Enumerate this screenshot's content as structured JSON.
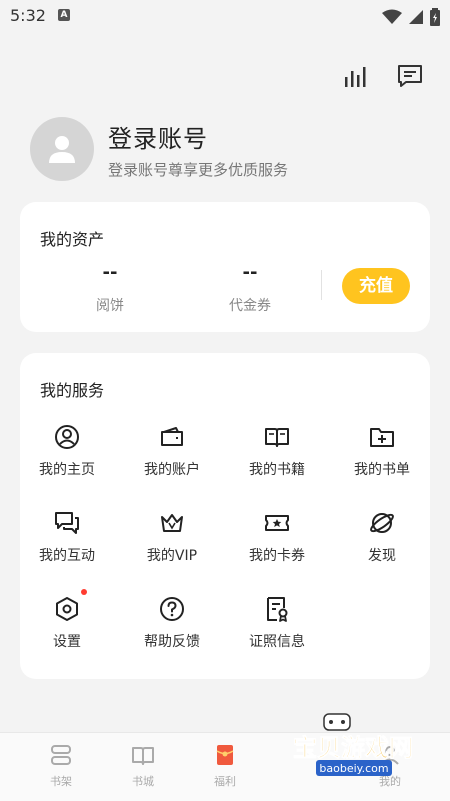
{
  "status_bar": {
    "time": "5:32",
    "a_badge": "A"
  },
  "top_actions": {
    "stats_icon": "bar-chart-icon",
    "message_icon": "message-icon"
  },
  "profile": {
    "title": "登录账号",
    "subtitle": "登录账号尊享更多优质服务"
  },
  "assets": {
    "title": "我的资产",
    "items": [
      {
        "value": "--",
        "label": "阅饼"
      },
      {
        "value": "--",
        "label": "代金券"
      }
    ],
    "recharge_label": "充值",
    "accent": "#ffc41f"
  },
  "services": {
    "title": "我的服务",
    "items": [
      {
        "label": "我的主页",
        "icon": "user-circle-icon"
      },
      {
        "label": "我的账户",
        "icon": "wallet-icon"
      },
      {
        "label": "我的书籍",
        "icon": "book-icon"
      },
      {
        "label": "我的书单",
        "icon": "folder-plus-icon"
      },
      {
        "label": "我的互动",
        "icon": "chat-icon"
      },
      {
        "label": "我的VIP",
        "icon": "crown-icon"
      },
      {
        "label": "我的卡券",
        "icon": "ticket-icon"
      },
      {
        "label": "发现",
        "icon": "planet-icon"
      },
      {
        "label": "设置",
        "icon": "settings-hex-icon"
      },
      {
        "label": "帮助反馈",
        "icon": "help-icon"
      },
      {
        "label": "证照信息",
        "icon": "license-icon"
      }
    ]
  },
  "bottom_nav": [
    {
      "label": "书架",
      "icon": "bookshelf-icon"
    },
    {
      "label": "书城",
      "icon": "bookstore-icon"
    },
    {
      "label": "福利",
      "icon": "red-envelope-icon"
    },
    {
      "label": "我的",
      "icon": "profile-icon"
    }
  ],
  "watermark": {
    "title": "宝贝游戏网",
    "url": "baobeiy.com"
  }
}
